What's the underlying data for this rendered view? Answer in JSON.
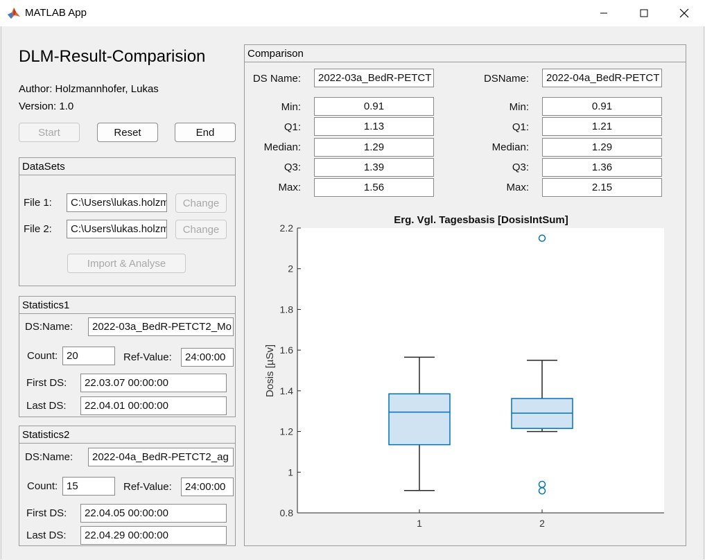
{
  "window": {
    "title": "MATLAB App"
  },
  "app": {
    "title": "DLM-Result-Comparision",
    "author": "Author: Holzmannhofer, Lukas",
    "version": "Version: 1.0",
    "buttons": {
      "start": "Start",
      "reset": "Reset",
      "end": "End"
    }
  },
  "datasets": {
    "title": "DataSets",
    "file1_label": "File 1:",
    "file1_value": "C:\\Users\\lukas.holzmannhofer",
    "file2_label": "File 2:",
    "file2_value": "C:\\Users\\lukas.holzmannhofer",
    "change_label": "Change",
    "import_label": "Import & Analyse"
  },
  "statistics1": {
    "title": "Statistics1",
    "dsname_label": "DS:Name:",
    "dsname_value": "2022-03a_BedR-PETCT2_Mo",
    "count_label": "Count:",
    "count_value": "20",
    "ref_label": "Ref-Value:",
    "ref_value": "24:00:00",
    "first_label": "First DS:",
    "first_value": "22.03.07 00:00:00",
    "last_label": "Last DS:",
    "last_value": "22.04.01 00:00:00"
  },
  "statistics2": {
    "title": "Statistics2",
    "dsname_label": "DS:Name:",
    "dsname_value": "2022-04a_BedR-PETCT2_ag",
    "count_label": "Count:",
    "count_value": "15",
    "ref_label": "Ref-Value:",
    "ref_value": "24:00:00",
    "first_label": "First DS:",
    "first_value": "22.04.05 00:00:00",
    "last_label": "Last DS:",
    "last_value": "22.04.29 00:00:00"
  },
  "comparison": {
    "title": "Comparison",
    "left": {
      "dsname_label": "DS Name:",
      "dsname_value": "2022-03a_BedR-PETCT",
      "min_label": "Min:",
      "min": "0.91",
      "q1_label": "Q1:",
      "q1": "1.13",
      "median_label": "Median:",
      "median": "1.29",
      "q3_label": "Q3:",
      "q3": "1.39",
      "max_label": "Max:",
      "max": "1.56"
    },
    "right": {
      "dsname_label": "DSName:",
      "dsname_value": "2022-04a_BedR-PETCT",
      "min_label": "Min:",
      "min": "0.91",
      "q1_label": "Q1:",
      "q1": "1.21",
      "median_label": "Median:",
      "median": "1.29",
      "q3_label": "Q3:",
      "q3": "1.36",
      "max_label": "Max:",
      "max": "2.15"
    }
  },
  "chart_data": {
    "type": "boxplot",
    "title": "Erg. Vgl. Tagesbasis [DosisIntSum]",
    "ylabel": "Dosis  [µSv]",
    "xlabel": "",
    "ylim": [
      0.8,
      2.2
    ],
    "yticks": [
      "0.8",
      "1",
      "1.2",
      "1.4",
      "1.6",
      "1.8",
      "2",
      "2.2"
    ],
    "categories": [
      "1",
      "2"
    ],
    "boxes": [
      {
        "whisker_low": 0.91,
        "q1": 1.135,
        "median": 1.295,
        "q3": 1.385,
        "whisker_high": 1.565,
        "outliers": []
      },
      {
        "whisker_low": 1.2,
        "q1": 1.215,
        "median": 1.29,
        "q3": 1.362,
        "whisker_high": 1.55,
        "outliers": [
          2.15,
          0.94,
          0.908
        ]
      }
    ],
    "box_color": "#0072bd",
    "box_fill": "#cfe3f3",
    "grid": false
  }
}
